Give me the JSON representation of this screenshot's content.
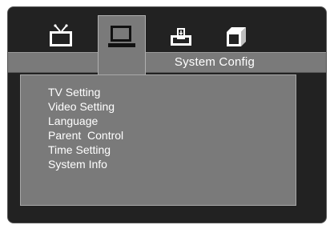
{
  "header": {
    "title": "System Config",
    "tabs": [
      {
        "icon": "tv-icon",
        "active": false
      },
      {
        "icon": "monitor-icon",
        "active": true
      },
      {
        "icon": "audio-icon",
        "active": false
      },
      {
        "icon": "preferences-icon",
        "active": false
      }
    ]
  },
  "menu": {
    "items": [
      "TV Setting",
      "Video Setting",
      "Language",
      "Parent  Control",
      "Time Setting",
      "System Info"
    ]
  },
  "colors": {
    "frame": "#222222",
    "bar": "#7a7a7a",
    "text": "#ffffff"
  }
}
